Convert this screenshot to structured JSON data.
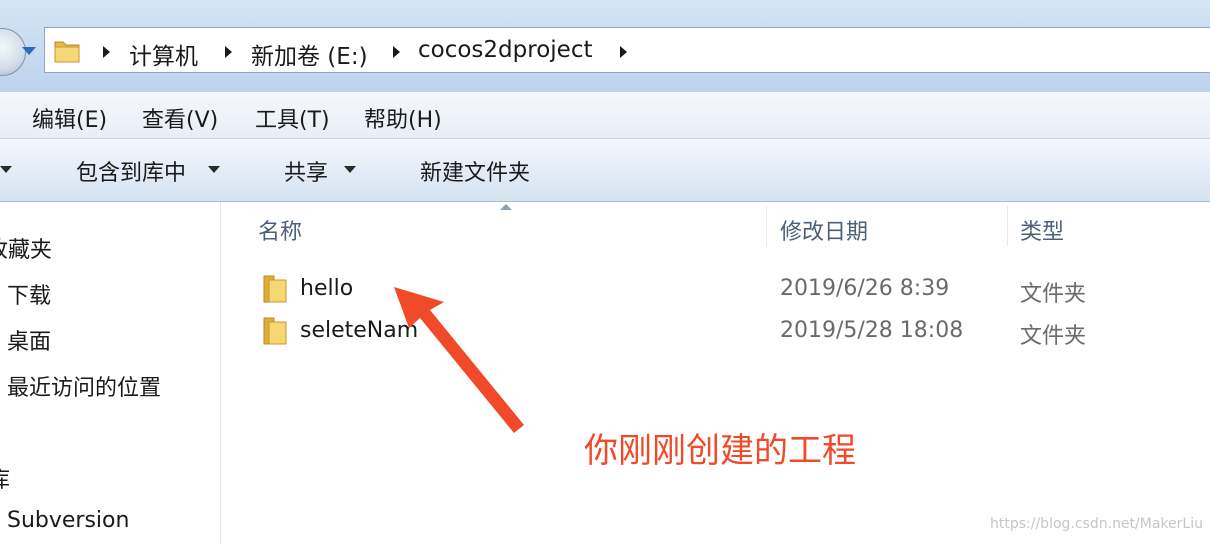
{
  "address_bar": {
    "folder_icon": "folder-icon",
    "crumbs": [
      "计算机",
      "新加卷 (E:)",
      "cocos2dproject"
    ]
  },
  "menu": {
    "edit": "编辑(E)",
    "view": "查看(V)",
    "tools": "工具(T)",
    "help": "帮助(H)"
  },
  "toolbar": {
    "include_in_library": "包含到库中",
    "share": "共享",
    "new_folder": "新建文件夹"
  },
  "nav": {
    "favorites": "收藏夹",
    "items": [
      "下载",
      "桌面",
      "最近访问的位置"
    ],
    "libraries": "库",
    "subversion": "Subversion"
  },
  "columns": {
    "name": "名称",
    "modified": "修改日期",
    "type": "类型"
  },
  "files": [
    {
      "name": "hello",
      "modified": "2019/6/26 8:39",
      "type": "文件夹"
    },
    {
      "name": "seleteNam",
      "modified": "2019/5/28 18:08",
      "type": "文件夹"
    }
  ],
  "annotation": {
    "text": "你刚刚创建的工程",
    "color": "#f04a2a"
  },
  "watermark": "https://blog.csdn.net/MakerLiu"
}
